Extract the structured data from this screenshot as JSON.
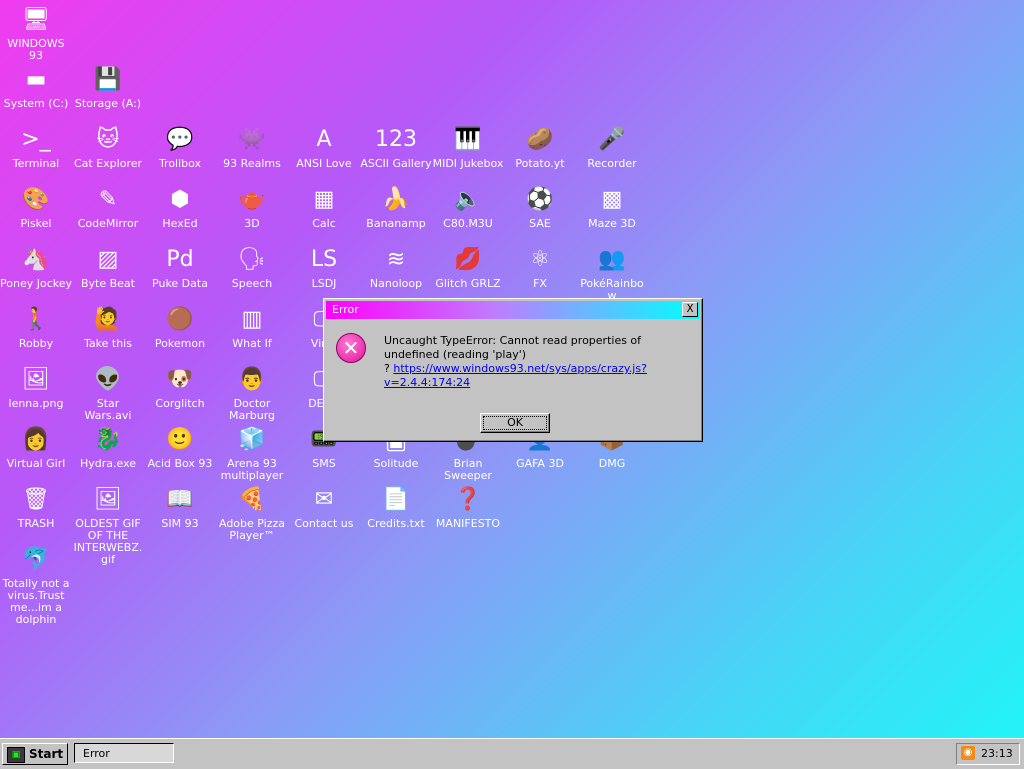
{
  "desktop": {
    "icons": [
      {
        "label": "WINDOWS 93",
        "glyph": "🖥"
      },
      {
        "label": "System (C:)",
        "glyph": "▬"
      },
      {
        "label": "Storage (A:)",
        "glyph": "💾"
      },
      {
        "label": "Terminal",
        "glyph": ">_"
      },
      {
        "label": "Cat Explorer",
        "glyph": "🐱"
      },
      {
        "label": "Trollbox",
        "glyph": "💬"
      },
      {
        "label": "93 Realms",
        "glyph": "👾"
      },
      {
        "label": "ANSI Love",
        "glyph": "A"
      },
      {
        "label": "ASCII Gallery",
        "glyph": "123"
      },
      {
        "label": "MIDI Jukebox",
        "glyph": "🎹"
      },
      {
        "label": "Potato.yt",
        "glyph": "🥔"
      },
      {
        "label": "Recorder",
        "glyph": "🎤"
      },
      {
        "label": "Piskel",
        "glyph": "🎨"
      },
      {
        "label": "CodeMirror",
        "glyph": "✎"
      },
      {
        "label": "HexEd",
        "glyph": "⬢"
      },
      {
        "label": "3D",
        "glyph": "🫖"
      },
      {
        "label": "Calc",
        "glyph": "▦"
      },
      {
        "label": "Bananamp",
        "glyph": "🍌"
      },
      {
        "label": "C80.M3U",
        "glyph": "🔈"
      },
      {
        "label": "SAE",
        "glyph": "⚽"
      },
      {
        "label": "Maze 3D",
        "glyph": "▩"
      },
      {
        "label": "Poney Jockey",
        "glyph": "🦄"
      },
      {
        "label": "Byte Beat",
        "glyph": "▨"
      },
      {
        "label": "Puke Data",
        "glyph": "Pd"
      },
      {
        "label": "Speech",
        "glyph": "🗣"
      },
      {
        "label": "LSDJ",
        "glyph": "LS"
      },
      {
        "label": "Nanoloop",
        "glyph": "≋"
      },
      {
        "label": "Glitch GRLZ",
        "glyph": "💋"
      },
      {
        "label": "FX",
        "glyph": "⚛"
      },
      {
        "label": "PokéRainbow",
        "glyph": "👥"
      },
      {
        "label": "Robby",
        "glyph": "🚶"
      },
      {
        "label": "Take this",
        "glyph": "🙋"
      },
      {
        "label": "Pokemon",
        "glyph": "🟤"
      },
      {
        "label": "What If",
        "glyph": "▥"
      },
      {
        "label": "Virtu",
        "glyph": "🖵"
      },
      {
        "label": "lenna.png",
        "glyph": "🖼"
      },
      {
        "label": "Star Wars.avi",
        "glyph": "👽"
      },
      {
        "label": "Corglitch",
        "glyph": "🐶"
      },
      {
        "label": "Doctor Marburg",
        "glyph": "👨"
      },
      {
        "label": "DERG",
        "glyph": "🖵"
      },
      {
        "label": "Virtual Girl",
        "glyph": "👩"
      },
      {
        "label": "Hydra.exe",
        "glyph": "🐉"
      },
      {
        "label": "Acid Box 93",
        "glyph": "🙂"
      },
      {
        "label": "Arena 93 multiplayer",
        "glyph": "🧊"
      },
      {
        "label": "SMS",
        "glyph": "📟"
      },
      {
        "label": "Solitude",
        "glyph": "🂠"
      },
      {
        "label": "Brian Sweeper",
        "glyph": "💣"
      },
      {
        "label": "GAFA 3D",
        "glyph": "👤"
      },
      {
        "label": "DMG",
        "glyph": "📦"
      },
      {
        "label": "TRASH",
        "glyph": "🗑"
      },
      {
        "label": "OLDEST GIF OF THE INTERWEBZ.gif",
        "glyph": "🖼"
      },
      {
        "label": "SIM 93",
        "glyph": "📖"
      },
      {
        "label": "Adobe Pizza Player™",
        "glyph": "🍕"
      },
      {
        "label": "Contact us",
        "glyph": "✉"
      },
      {
        "label": "Credits.txt",
        "glyph": "📄"
      },
      {
        "label": "MANIFESTO",
        "glyph": "❓"
      },
      {
        "label": "Totally not a virus.Trust me...im a dolphin",
        "glyph": "🐬"
      }
    ]
  },
  "dialog": {
    "title": "Error",
    "close_label": "X",
    "message": "Uncaught TypeError: Cannot read properties of undefined (reading 'play')",
    "prefix": "?",
    "link": "https://www.windows93.net/sys/apps/crazy.js?v=2.4.4:174:24",
    "ok_label": "OK",
    "icon": "error-icon"
  },
  "taskbar": {
    "start_label": "Start",
    "task_label": "Error",
    "clock": "23:13"
  },
  "colors": {
    "titlebar_start": "#ff00ff",
    "titlebar_end": "#00ffff",
    "error_icon": "#e0139b"
  }
}
